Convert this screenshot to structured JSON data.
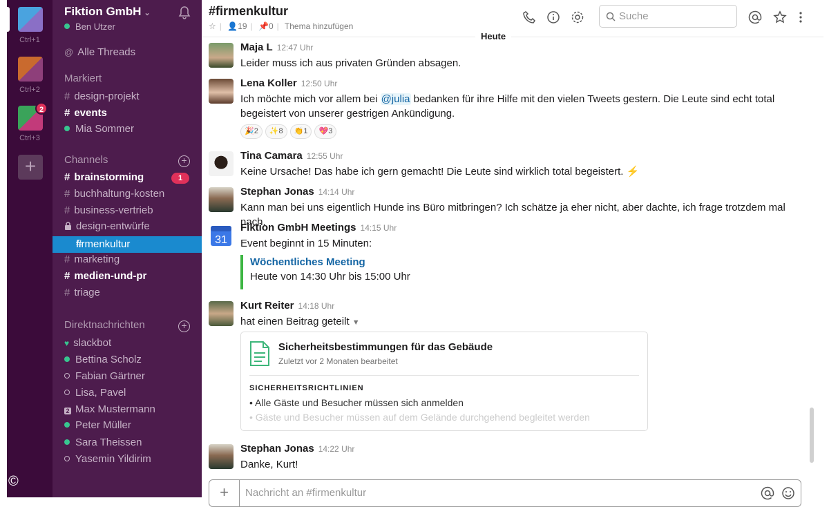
{
  "teams": [
    {
      "shortcut": "Ctrl+1",
      "color_a": "#4aa3df",
      "color_b": "#8a6fc6"
    },
    {
      "shortcut": "Ctrl+2",
      "color_a": "#c96a2e",
      "color_b": "#8e3f7a"
    },
    {
      "shortcut": "Ctrl+3",
      "color_a": "#3aa35a",
      "color_b": "#c23a7a",
      "badge": "2"
    }
  ],
  "add_team_label": "+",
  "copyright_symbol": "©",
  "workspace": {
    "name": "Fiktion GmbH",
    "caret": "⌄",
    "user": "Ben Utzer"
  },
  "sidebar": {
    "all_threads": "Alle Threads",
    "starred_header": "Markiert",
    "starred": [
      {
        "name": "design-projekt",
        "bold": false
      },
      {
        "name": "events",
        "bold": true
      }
    ],
    "starred_dm": "Mia Sommer",
    "channels_header": "Channels",
    "channels": [
      {
        "name": "brainstorming",
        "bold": true,
        "badge": "1"
      },
      {
        "name": "buchhaltung-kosten"
      },
      {
        "name": "business-vertrieb"
      },
      {
        "name": "design-entwürfe",
        "locked": true
      },
      {
        "name": "firmenkultur",
        "active": true
      },
      {
        "name": "marketing"
      },
      {
        "name": "medien-und-pr",
        "bold": true
      },
      {
        "name": "triage"
      }
    ],
    "dm_header": "Direktnachrichten",
    "dms": [
      {
        "name": "slackbot",
        "status": "heart"
      },
      {
        "name": "Bettina Scholz",
        "status": "online"
      },
      {
        "name": "Fabian Gärtner",
        "status": "away"
      },
      {
        "name": "Lisa, Pavel",
        "status": "away"
      },
      {
        "name": "Max Mustermann",
        "status": "group",
        "group_count": "2"
      },
      {
        "name": "Peter Müller",
        "status": "online"
      },
      {
        "name": "Sara Theissen",
        "status": "online"
      },
      {
        "name": "Yasemin Yildirim",
        "status": "away"
      }
    ]
  },
  "channel": {
    "title": "#firmenkultur",
    "members": "19",
    "pins": "0",
    "topic": "Thema hinzufügen",
    "search_placeholder": "Suche",
    "day_divider": "Heute"
  },
  "messages": [
    {
      "author": "Maja L",
      "time": "12:47 Uhr",
      "text": "Leider muss ich aus privaten Gründen absagen."
    },
    {
      "author": "Lena Koller",
      "time": "12:50 Uhr",
      "text_before": "Ich möchte mich vor allem bei ",
      "mention": "@julia",
      "text_after": " bedanken für ihre Hilfe mit den vielen Tweets gestern. Die Leute sind echt total begeistert von unserer gestrigen Ankündigung.",
      "reactions": [
        {
          "emoji": "🎉",
          "count": "2"
        },
        {
          "emoji": "✨",
          "count": "8"
        },
        {
          "emoji": "👏",
          "count": "1"
        },
        {
          "emoji": "💖",
          "count": "3"
        }
      ]
    },
    {
      "author": "Tina Camara",
      "time": "12:55 Uhr",
      "text": "Keine Ursache! Das habe ich gern gemacht! Die Leute sind wirklich total begeistert. ⚡"
    },
    {
      "author": "Stephan Jonas",
      "time": "14:14 Uhr",
      "text": "Kann man bei uns eigentlich Hunde ins Büro mitbringen? Ich schätze ja eher nicht, aber dachte, ich frage trotzdem mal nach."
    },
    {
      "author": "Fiktion GmbH Meetings",
      "time": "14:15 Uhr",
      "text": "Event beginnt in 15 Minuten:",
      "calendar_day": "31",
      "attachment": {
        "title": "Wöchentliches Meeting",
        "text": "Heute von 14:30 Uhr bis 15:00 Uhr"
      }
    },
    {
      "author": "Kurt Reiter",
      "time": "14:18 Uhr",
      "text": "hat einen Beitrag geteilt",
      "post": {
        "title": "Sicherheitsbestimmungen für das Gebäude",
        "subtitle": "Zuletzt vor 2 Monaten bearbeitet",
        "heading": "SICHERHEITSRICHTLINIEN",
        "bullet1": "• Alle Gäste und Besucher müssen sich anmelden",
        "bullet2": "• Gäste und Besucher müssen auf dem Gelände durchgehend begleitet werden"
      }
    },
    {
      "author": "Stephan Jonas",
      "time": "14:22 Uhr",
      "text": "Danke, Kurt!"
    }
  ],
  "composer": {
    "plus": "+",
    "placeholder": "Nachricht an #firmenkultur"
  },
  "colors": {
    "team_bar": "#3b0b3a",
    "sidebar": "#4d1c4d",
    "active": "#1a8acf",
    "badge": "#e0315a",
    "presence": "#38c590",
    "link": "#1264a3"
  }
}
